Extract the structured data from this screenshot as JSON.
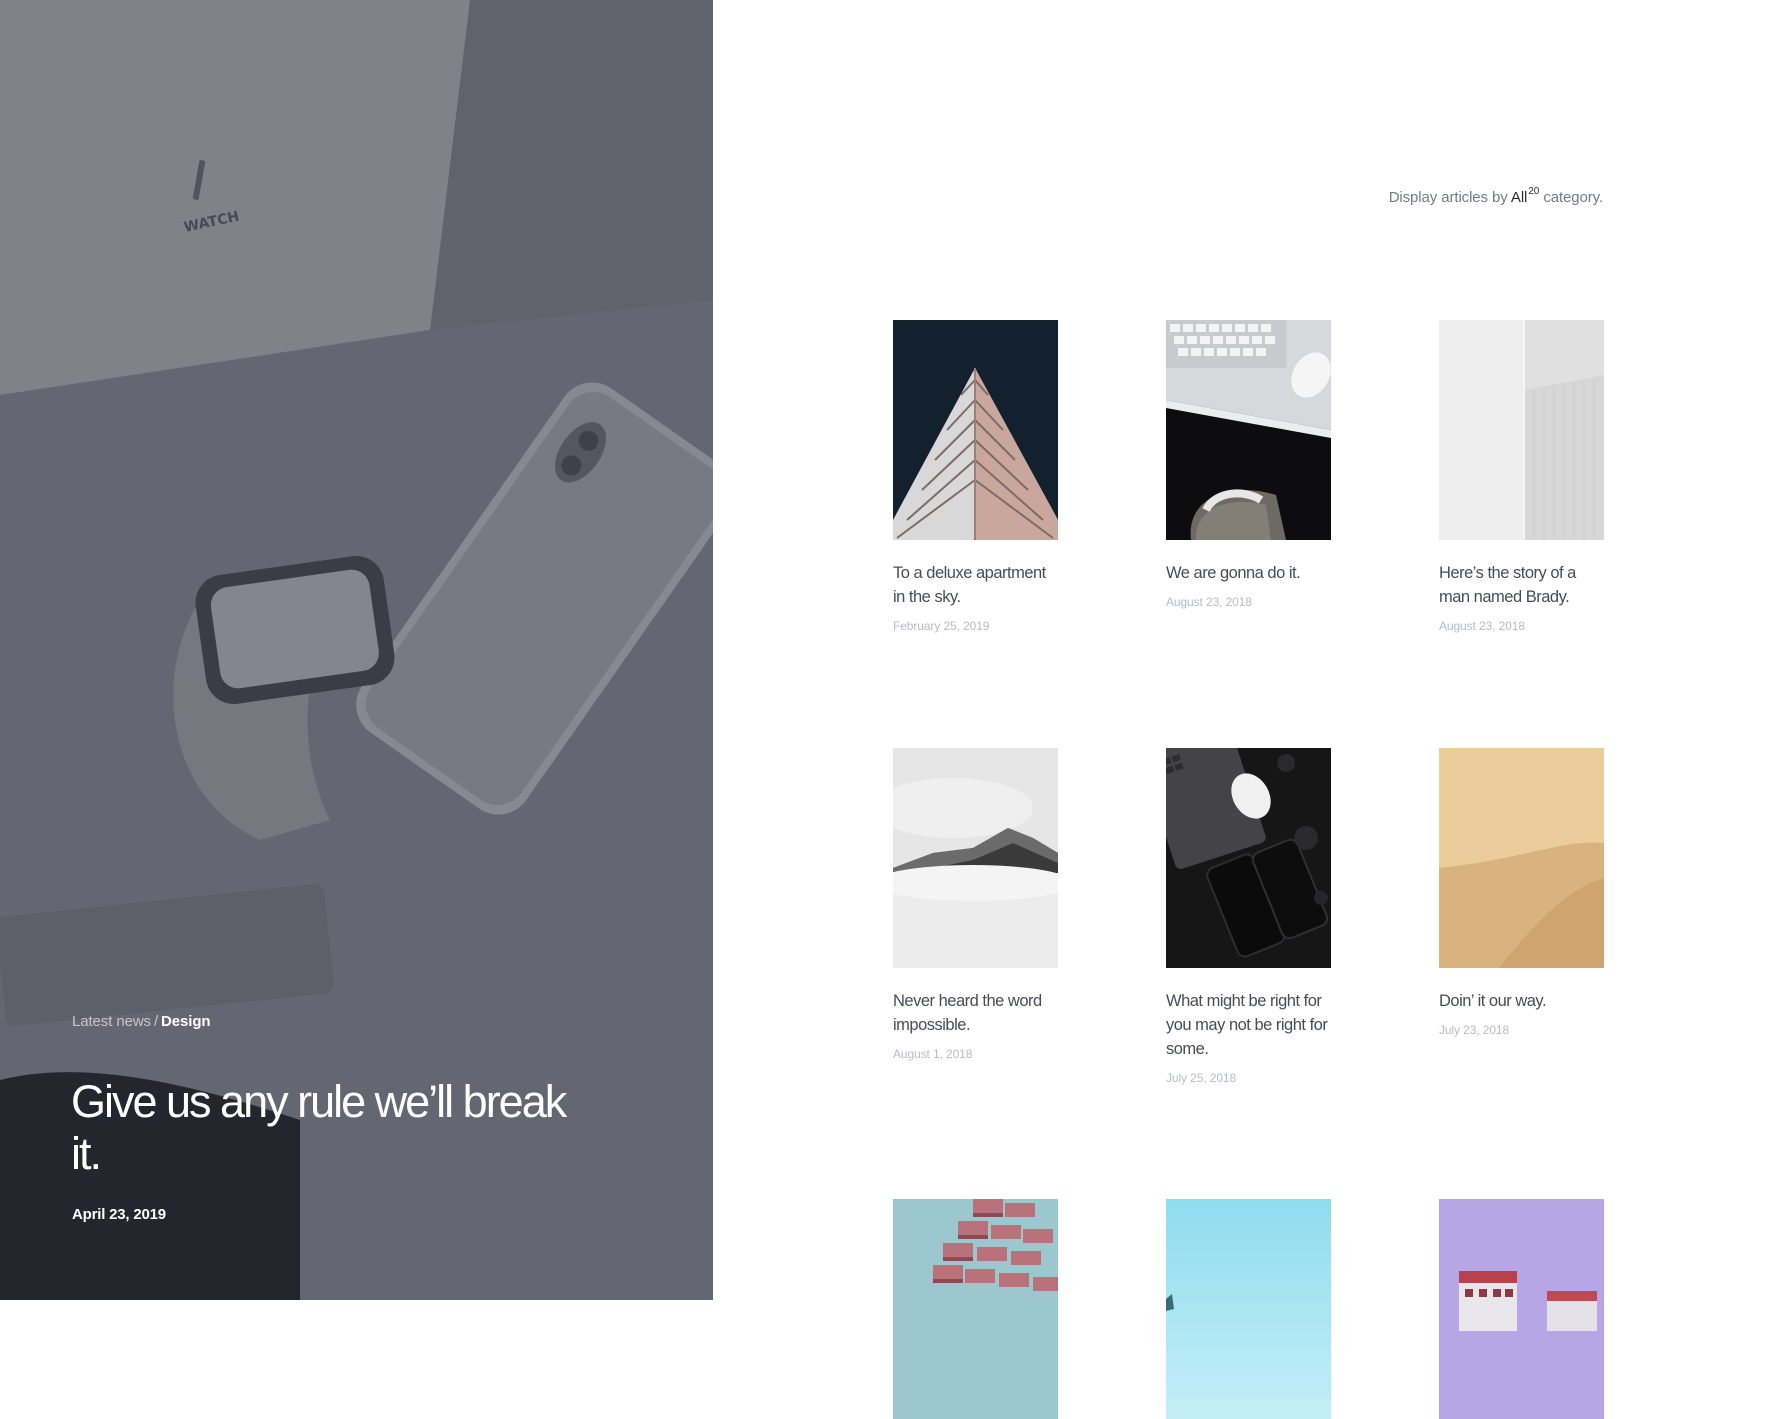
{
  "hero": {
    "breadcrumb": {
      "parent": "Latest news",
      "separator": "/",
      "current": "Design"
    },
    "title": "Give us any rule we’ll break it.",
    "date": "April 23, 2019"
  },
  "filter": {
    "prefix": "Display articles by",
    "category": "All",
    "count": "20",
    "suffix": "category."
  },
  "articles": [
    {
      "title": "To a deluxe apartment in the sky.",
      "date": "February 25, 2019"
    },
    {
      "title": "We are gonna do it.",
      "date": "August 23, 2018"
    },
    {
      "title": "Here’s the story of a man named Brady.",
      "date": "August 23, 2018"
    },
    {
      "title": "Never heard the word impossible.",
      "date": "August 1, 2018"
    },
    {
      "title": "What might be right for you may not be right for some.",
      "date": "July 25, 2018"
    },
    {
      "title": "Doin’ it our way.",
      "date": "July 23, 2018"
    }
  ],
  "colors": {
    "heroOverlay": "#6c6e78",
    "title": "#4a4c52",
    "date": "#b9bbbf",
    "accent": "#2b2d32"
  }
}
